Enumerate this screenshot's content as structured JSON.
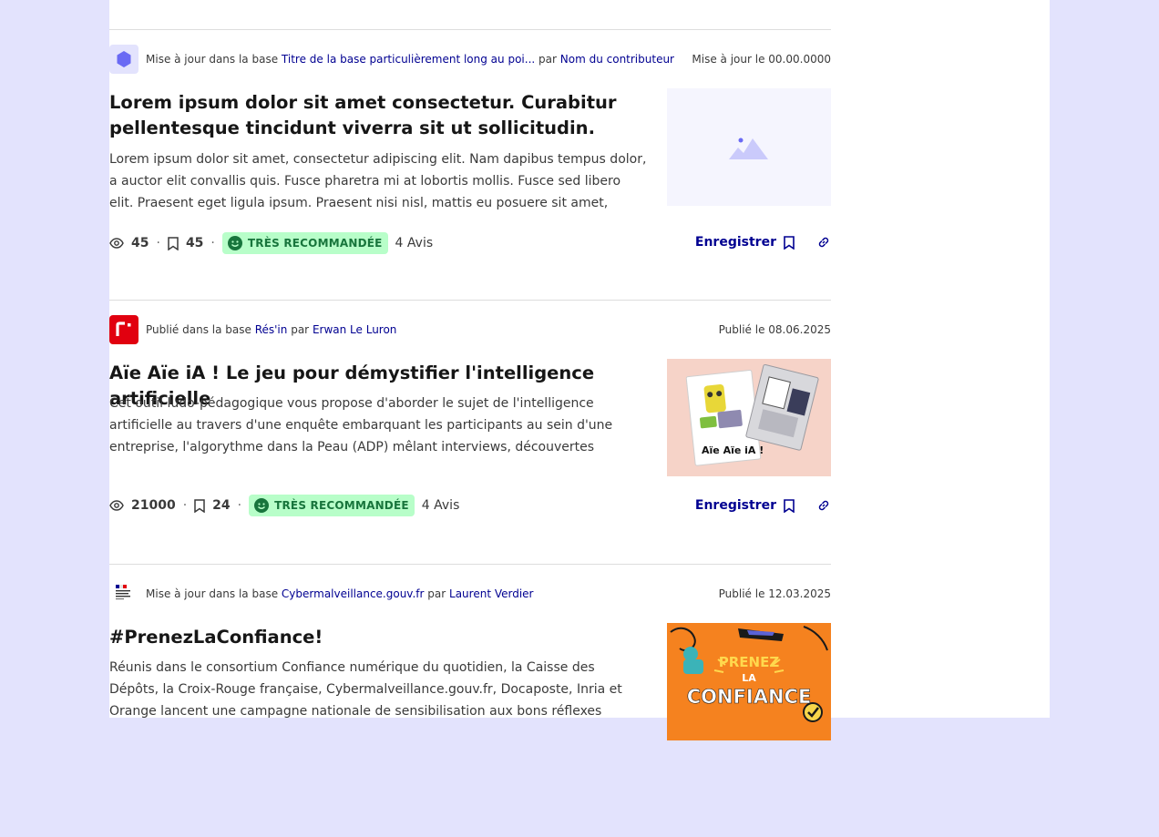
{
  "resources": [
    {
      "meta_prefix": "Mise à jour dans la base",
      "base_name": "Titre de la base particulièrement long au poi...",
      "by": "par",
      "contributor": "Nom du contributeur",
      "date": "Mise à jour le 00.00.0000",
      "base_logo_icon": "hexagon-icon",
      "title": "Lorem ipsum dolor sit amet consectetur. Curabitur pellentesque tincidunt viverra sit ut sollicitudin.",
      "excerpt": "Lorem ipsum dolor sit amet, consectetur adipiscing elit. Nam dapibus tempus dolor, a auctor elit convallis quis. Fusce pharetra mi at lobortis mollis. Fusce sed libero elit. Praesent eget ligula ipsum. Praesent nisi nisl, mattis eu posuere sit amet, tincidunt in e...",
      "views": "45",
      "saves": "45",
      "badge": "TRÈS RECOMMANDÉE",
      "reviews": "4 Avis",
      "save_label": "Enregistrer",
      "thumb_icon": "image-placeholder-icon"
    },
    {
      "meta_prefix": "Publié dans la base",
      "base_name": "Rés'in",
      "by": "par",
      "contributor": "Erwan Le Luron",
      "date": "Publié le 08.06.2025",
      "base_logo_icon": "resin-logo-icon",
      "title": "Aïe Aïe iA ! Le jeu pour démystifier l'intelligence artificielle",
      "excerpt": "Cet outil ludo-pédagogique vous propose d'aborder le sujet de l'intelligence artificielle au travers d'une enquête embarquant les participants au sein d'une entreprise, l'algorythme dans la Peau (ADP) mêlant interviews, découvertes d'environnements et...",
      "views": "21000",
      "saves": "24",
      "badge": "TRÈS RECOMMANDÉE",
      "reviews": "4 Avis",
      "save_label": "Enregistrer",
      "thumb_text": "Aïe Aïe iA !"
    },
    {
      "meta_prefix": "Mise à jour dans la base",
      "base_name": "Cybermalveillance.gouv.fr",
      "by": "par",
      "contributor": "Laurent Verdier",
      "date": "Publié le 12.03.2025",
      "base_logo_icon": "republique-francaise-logo-icon",
      "title": "#PrenezLaConfiance!",
      "excerpt": "Réunis dans le consortium Confiance numérique du quotidien, la Caisse des Dépôts, la Croix-Rouge française, Cybermalveillance.gouv.fr, Docaposte, Inria et Orange lancent une campagne nationale de sensibilisation aux bons réflexes auprès du grand public....",
      "thumb_text_1": "PRENEZ",
      "thumb_text_2": "LA",
      "thumb_text_3": "CONFIANCE"
    }
  ],
  "colors": {
    "page_bg": "#e3e3fd",
    "link": "#000091",
    "badge_bg": "#b8fec9",
    "badge_text": "#18753c",
    "placeholder_bg": "#f5f5fe"
  }
}
